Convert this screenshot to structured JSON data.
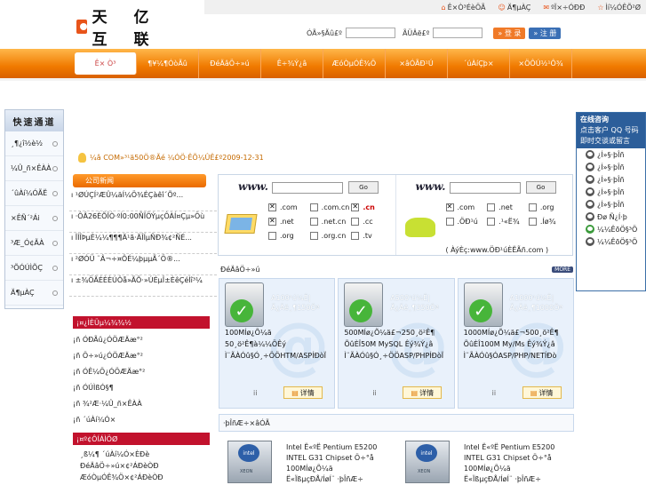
{
  "logo": {
    "text": "天 亿 互 联"
  },
  "top_links": [
    "Ê×Ò³ÉèÖÃ",
    "Ä¶µÀÇ",
    "ºÏ×÷ÓÐÐ",
    "Ìí¼ÓÊÕ²Ø"
  ],
  "login": {
    "user_label": "ÓÃ»§Ãû£º",
    "pass_label": "ÃÜÂë£º",
    "login_btn": "登 录",
    "reg_btn": "注 册"
  },
  "nav": [
    "Ê× Ò³",
    "¶¥¼¶ÓòÃû",
    "ÐéÄâÖ÷»ú",
    "Ê÷¾Ý¿â",
    "ÆóÒµÓÊ¾Ö",
    "×âÓÃÐ¹Ú",
    "´úÀíÇþ×",
    "×ÖÔÚ½¹Ô¾"
  ],
  "quick": {
    "title": "快速通道",
    "items": [
      "¸¶¿î½è½",
      "¼Û_ñ×ÊÀÀ",
      "´ûÀí¼ÓÃË",
      "×ÊÑ´²Ái",
      "³Æ_Ó¢ÃÀ",
      "³ÕÓÚÌÕÇ",
      "Ä¶µÀÇ"
    ]
  },
  "online": {
    "title": "在线咨询",
    "subtitle": "点击客户 QQ 号码即时交谈或留言",
    "reps": [
      "¿Í»§·þÎñ",
      "¿Í»§·þÎñ",
      "¿Í»§·þÎñ",
      "¿Í»§·þÎñ",
      "¿Í»§·þÎñ",
      "Ðø Ñ¿Í·þ",
      "¼¼ÊõÖ§³Ö",
      "¼¼ÊõÖ§³Ö"
    ]
  },
  "marquee": "¼â COM»³¹ä50Ö®Ãé ¼ÓÖ·ÊÕ¼ÛÊ£º2009-12-31",
  "news_tab": "公司新闻",
  "news": [
    "¹ØÚÇÍ²ÆÛ¼äÍ¼Ö¾ÉÇàêî´Õº...",
    "·ÔÂ26ÈÕÎÒ·ºÍ0:00ÑÏÖÝµçÔÀÍ¤Çµ»Öù",
    "ÏÍÎÞµÈ¼¼¶¶¶Ä¹ã·ÄÎÍµÑÐ¾­¢²ÑÉ...",
    "²ØÓÜ ¨Â¬÷¤ÔÉ¼þµµÃ´Ö®...",
    "±¾ÖÃÉÈÈÚÔå»ÃÕ·»ÚÉµÎ±ÈêÇéÌî³¼"
  ],
  "sec1": {
    "title": "¡¤¿ÌÈÜµ¼¾¾½",
    "links": [
      "¡ñ ÓÐÃû¿ÓÖÆÄæ°²",
      "¡ñ Ö÷»ú¿ÓÖÆÄæ°²",
      "¡ñ ÓÊ¼Ö¿ÓÖÆÄæ°²",
      "¡ñ ÓÚÌßÓ§¶",
      "¡ñ ¾²Æ·¼Û_ñ×ÊÀÀ",
      "¡ñ ´úÀí¼Ó×"
    ]
  },
  "sec2": {
    "title": "¡¤º¢ÔÍÁÌÖØ",
    "links": [
      "¸ß¼¶ ´úÀí¼Ó×ÈÐè",
      "ÐéÄâÖ÷»ú×¢²ÁÐèÒÐ",
      "ÆóÒµÓÊ¾Ö×¢²ÁÐèÒÐ"
    ]
  },
  "domain_box": {
    "left": {
      "www": "www.",
      "go": "Go",
      "opts": [
        {
          "t": ".com",
          "on": true,
          "red": false
        },
        {
          "t": ".com.cn",
          "on": false,
          "red": false
        },
        {
          "t": ".cn",
          "on": true,
          "red": true
        },
        {
          "t": ".net",
          "on": true,
          "red": false
        },
        {
          "t": ".net.cn",
          "on": false,
          "red": false
        },
        {
          "t": ".cc",
          "on": false,
          "red": false
        },
        {
          "t": ".org",
          "on": false,
          "red": false
        },
        {
          "t": ".org.cn",
          "on": false,
          "red": false
        },
        {
          "t": ".tv",
          "on": false,
          "red": false
        }
      ]
    },
    "right": {
      "www": "www.",
      "go": "Go",
      "opts": [
        {
          "t": ".com",
          "on": true,
          "red": false
        },
        {
          "t": ".net",
          "on": false,
          "red": false
        },
        {
          "t": ".org",
          "on": false,
          "red": false
        },
        {
          "t": ".ÖÐ¹ú",
          "on": false,
          "red": false
        },
        {
          "t": ".¹«Ë¾",
          "on": false,
          "red": false
        },
        {
          "t": ".Íø¾",
          "on": false,
          "red": false
        }
      ],
      "note": "( ÀýÈç:www.ÖÐ¹úÈËÃñ.com )"
    }
  },
  "hosting": {
    "title": "ÐéÄâÖ÷»ú",
    "more": "MORE",
    "cards": [
      {
        "price": "A100¹ú¼Ê|Ã¿Äê¸¶150Ôª",
        "desc": [
          "100MÍø¿Õ¼ä",
          "50¸ö²Ê¶à¼¼ÖÊý",
          "Ì¨ÃÀÓû§Ó¸÷ÖÖHTM/ASPÍÐòÏ"
        ],
        "detail": "详情",
        "ii": "ii"
      },
      {
        "price": "A500¹ú¼Ê|Ã¿Äê¸¶350Ôª",
        "desc": [
          "500MÍø¿Õ¼ä£¬250¸ö²Ê¶",
          "ÕûÈÎ50M MySQL Êý¾Ý¿â",
          "Ì¨ÃÀÓû§Ó¸÷ÖÖASP/PHPÍÐòÏ"
        ],
        "detail": "详情",
        "ii": "ii"
      },
      {
        "price": "A1000¹ú¼Ê|Ã¿Äê¸¶1000Ôª",
        "desc": [
          "1000MÍø¿Õ¼ä£¬500¸ö²Ê¶",
          "ÕûÈÎ100M My/Ms Êý¾Ý¿â",
          "Ì¨ÃÀÓû§ÓASP/PHP/NETÍÐò"
        ],
        "detail": "详情",
        "ii": "ii"
      }
    ]
  },
  "servers": {
    "title": "·þÎñÆ÷×âÓÃ",
    "cards": [
      {
        "chip": "intel",
        "label": "XEON",
        "desc": [
          "Intel Ë«ºË Pentium E5200",
          "INTEL G31 Chipset Ö÷°å",
          "100MÍø¿Õ¼ä",
          "Ë«ÏßµçÐÅ/ÍøÍ¨ ·þÎñÆ÷"
        ]
      },
      {
        "chip": "intel",
        "label": "XEON",
        "desc": [
          "Intel Ë«ºË Pentium E5200",
          "INTEL G31 Chipset Ö÷°å",
          "100MÍø¿Õ¼ä",
          "Ë«ÏßµçÐÅ/ÍøÍ¨ ·þÎñÆ÷"
        ]
      }
    ]
  }
}
